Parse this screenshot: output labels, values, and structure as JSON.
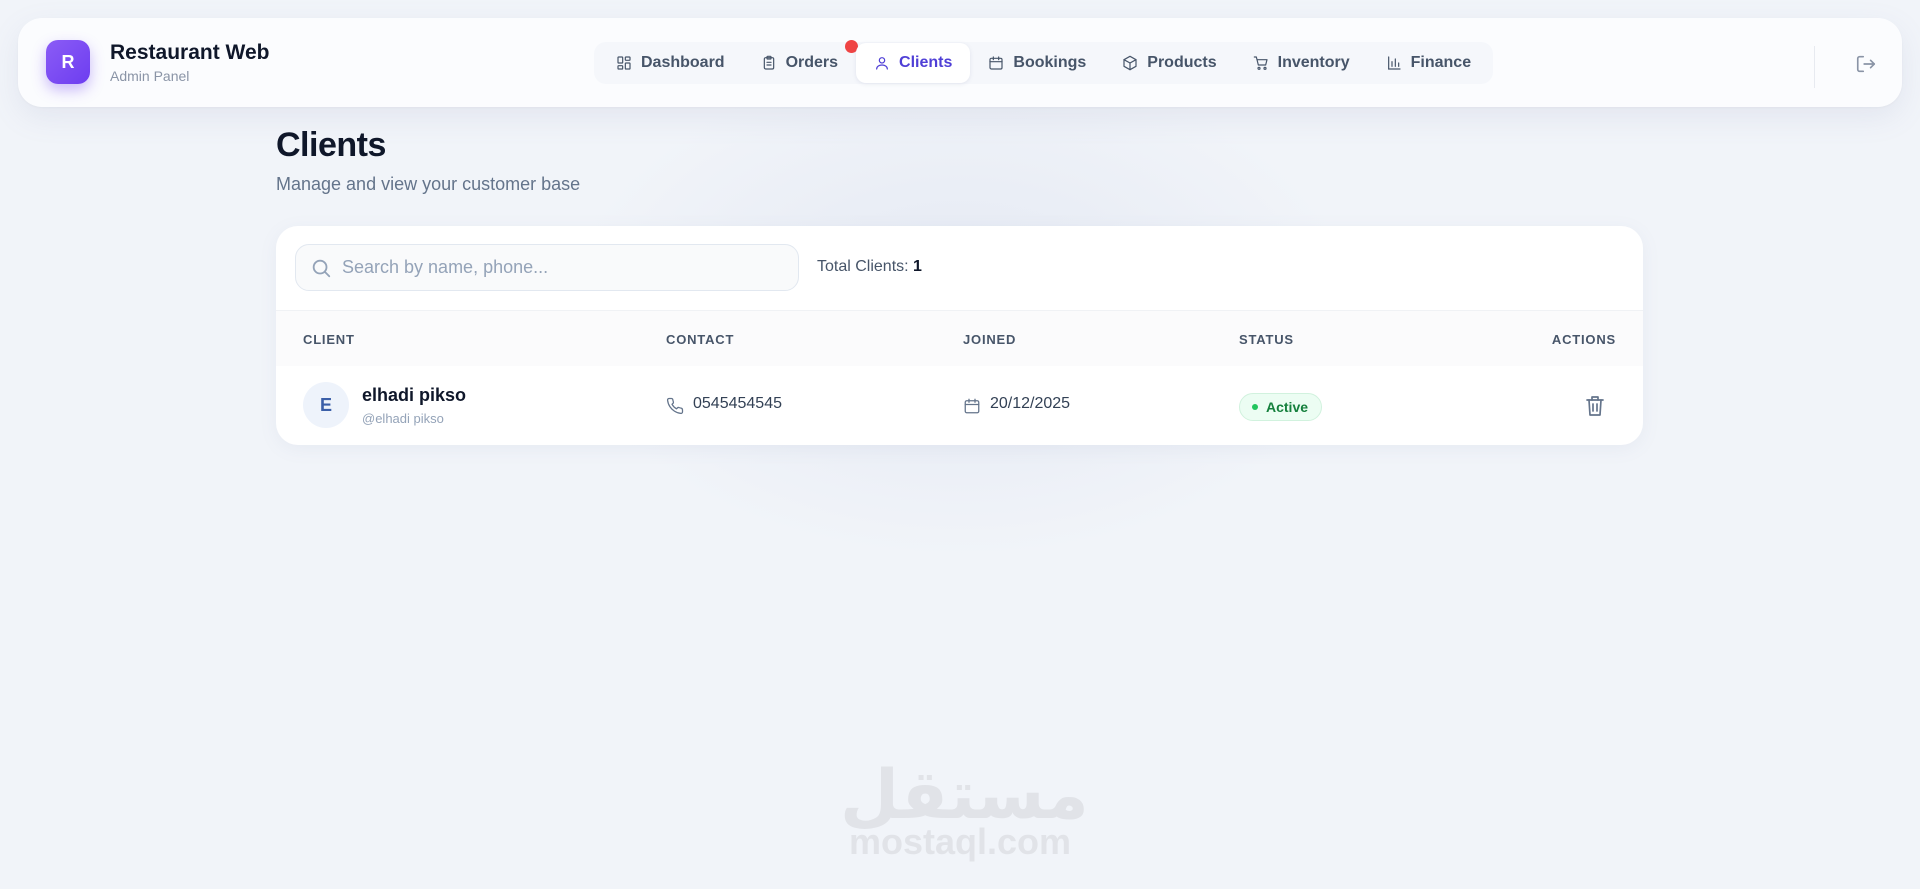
{
  "brand": {
    "logo_letter": "R",
    "title": "Restaurant Web",
    "subtitle": "Admin Panel"
  },
  "nav": {
    "items": [
      {
        "label": "Dashboard",
        "icon": "dashboard-grid-icon"
      },
      {
        "label": "Orders",
        "icon": "clipboard-icon",
        "badge": true
      },
      {
        "label": "Clients",
        "icon": "user-icon",
        "active": true
      },
      {
        "label": "Bookings",
        "icon": "calendar-icon"
      },
      {
        "label": "Products",
        "icon": "box-icon"
      },
      {
        "label": "Inventory",
        "icon": "cart-icon"
      },
      {
        "label": "Finance",
        "icon": "bar-chart-icon"
      }
    ]
  },
  "page": {
    "title": "Clients",
    "subtitle": "Manage and view your customer base"
  },
  "search": {
    "placeholder": "Search by name, phone...",
    "value": ""
  },
  "summary": {
    "label": "Total Clients:",
    "count": "1"
  },
  "table": {
    "headers": {
      "client": "CLIENT",
      "contact": "CONTACT",
      "joined": "JOINED",
      "status": "STATUS",
      "actions": "ACTIONS"
    },
    "rows": [
      {
        "initial": "E",
        "name": "elhadi pikso",
        "handle": "@elhadi pikso",
        "phone": "0545454545",
        "joined": "20/12/2025",
        "status": "Active"
      }
    ]
  },
  "watermark": {
    "arabic": "مستقل",
    "latin": "mostaql.com"
  },
  "colors": {
    "accent": "#4f3fd6",
    "brand": "#6d3df0",
    "status_active": "#15803d",
    "badge": "#ef4444"
  }
}
